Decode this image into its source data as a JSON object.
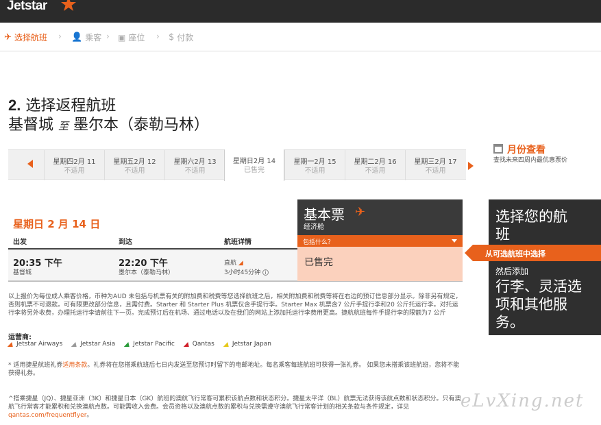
{
  "brand": {
    "name": "Jetstar",
    "accent": "#e8611c"
  },
  "steps": [
    {
      "label": "选择航班",
      "icon": "plane-icon",
      "active": true
    },
    {
      "label": "乘客",
      "icon": "person-icon",
      "active": false
    },
    {
      "label": "座位",
      "icon": "seat-icon",
      "active": false
    },
    {
      "label": "付款",
      "icon": "dollar-icon",
      "active": false
    }
  ],
  "heading": {
    "num": "2.",
    "title": "选择返程航班",
    "origin": "基督城",
    "to": "至",
    "destination": "墨尔本（泰勒马林）"
  },
  "dates": [
    {
      "day": "星期四2月 11",
      "status": "不适用"
    },
    {
      "day": "星期五2月 12",
      "status": "不适用"
    },
    {
      "day": "星期六2月 13",
      "status": "不适用"
    },
    {
      "day": "星期日2月 14",
      "status": "已售完"
    },
    {
      "day": "星期一2月 15",
      "status": "不适用"
    },
    {
      "day": "星期二2月 16",
      "status": "不适用"
    },
    {
      "day": "星期三2月 17",
      "status": "不适用"
    }
  ],
  "month_view": {
    "label": "月份查看",
    "sub": "查找未来四周内最优惠票价"
  },
  "day_title": "星期日 2 月 14 日",
  "columns": {
    "depart": "出发",
    "arrive": "到达",
    "details": "航班详情"
  },
  "flight": {
    "depart_time": "20:35 下午",
    "depart_place": "基督城",
    "arrive_time": "22:20 下午",
    "arrive_place": "墨尔本（泰勒马林）",
    "type": "直航",
    "duration": "3小时45分钟"
  },
  "fare": {
    "title": "基本票",
    "class": "经济舱",
    "includes": "包括什么？",
    "status": "已售完"
  },
  "notes": "以上报价为每位成人乘客价格，币种为AUD 未包括与机票有关的附加费和税费等您选择航班之后，相关附加费和税费等将在右边的预订信息部分显示。除非另有规定，否则机票不可退款。可有限更改部分信息，且需付费。Starter 和 Starter Plus 机票仅含手提行李。Starter Max 机票含7 公斤手提行李和20 公斤托运行李。对托运行李将另外收费，办理托运行李请前往下一页。完成预订后在机场、通过电话以及在我们的网站上添加托运行李费用更高。捷航航班每件手提行李的限额为7 公斤",
  "operators_title": "运营商:",
  "operators": [
    {
      "name": "Jetstar Airways",
      "color": "#e8611c"
    },
    {
      "name": "Jetstar Asia",
      "color": "#999999"
    },
    {
      "name": "Jetstar Pacific",
      "color": "#2a9b3a"
    },
    {
      "name": "Qantas",
      "color": "#d0202a"
    },
    {
      "name": "Jetstar Japan",
      "color": "#e6c81a"
    }
  ],
  "note2_pre": "* 适用捷星航班礼券",
  "note2_link": "适用条款",
  "note2_post": "。礼券将在您搭乘航班后七日内发送至您预订时留下的电邮地址。每名乘客每班航班可获得一张礼券。 如果您未搭乘该班航班，您将不能获得礼券。",
  "note3_pre": "^搭乘捷星（JQ）、捷星亚洲（3K）和捷星日本（GK）航班的澳航飞行常客可累积该航点数和状态积分。捷星太平洋（BL）航票无法获得该航点数和状态积分。只有澳航飞行常客才能累积和兑换澳航点数。可能需收入会费。会员资格以及澳航点数的累积与兑换需遵守澳航飞行常客计划的相关条款与条件规定，详见",
  "note3_link": "qantas.com/frequentflyer",
  "note3_post": "。",
  "promo": {
    "line1": "选择您的航班",
    "arrow": "从可选航班中选择",
    "line2": "然后添加",
    "line3": "行李、灵活选项和其他服务。"
  },
  "watermark": "eLvXing.net"
}
